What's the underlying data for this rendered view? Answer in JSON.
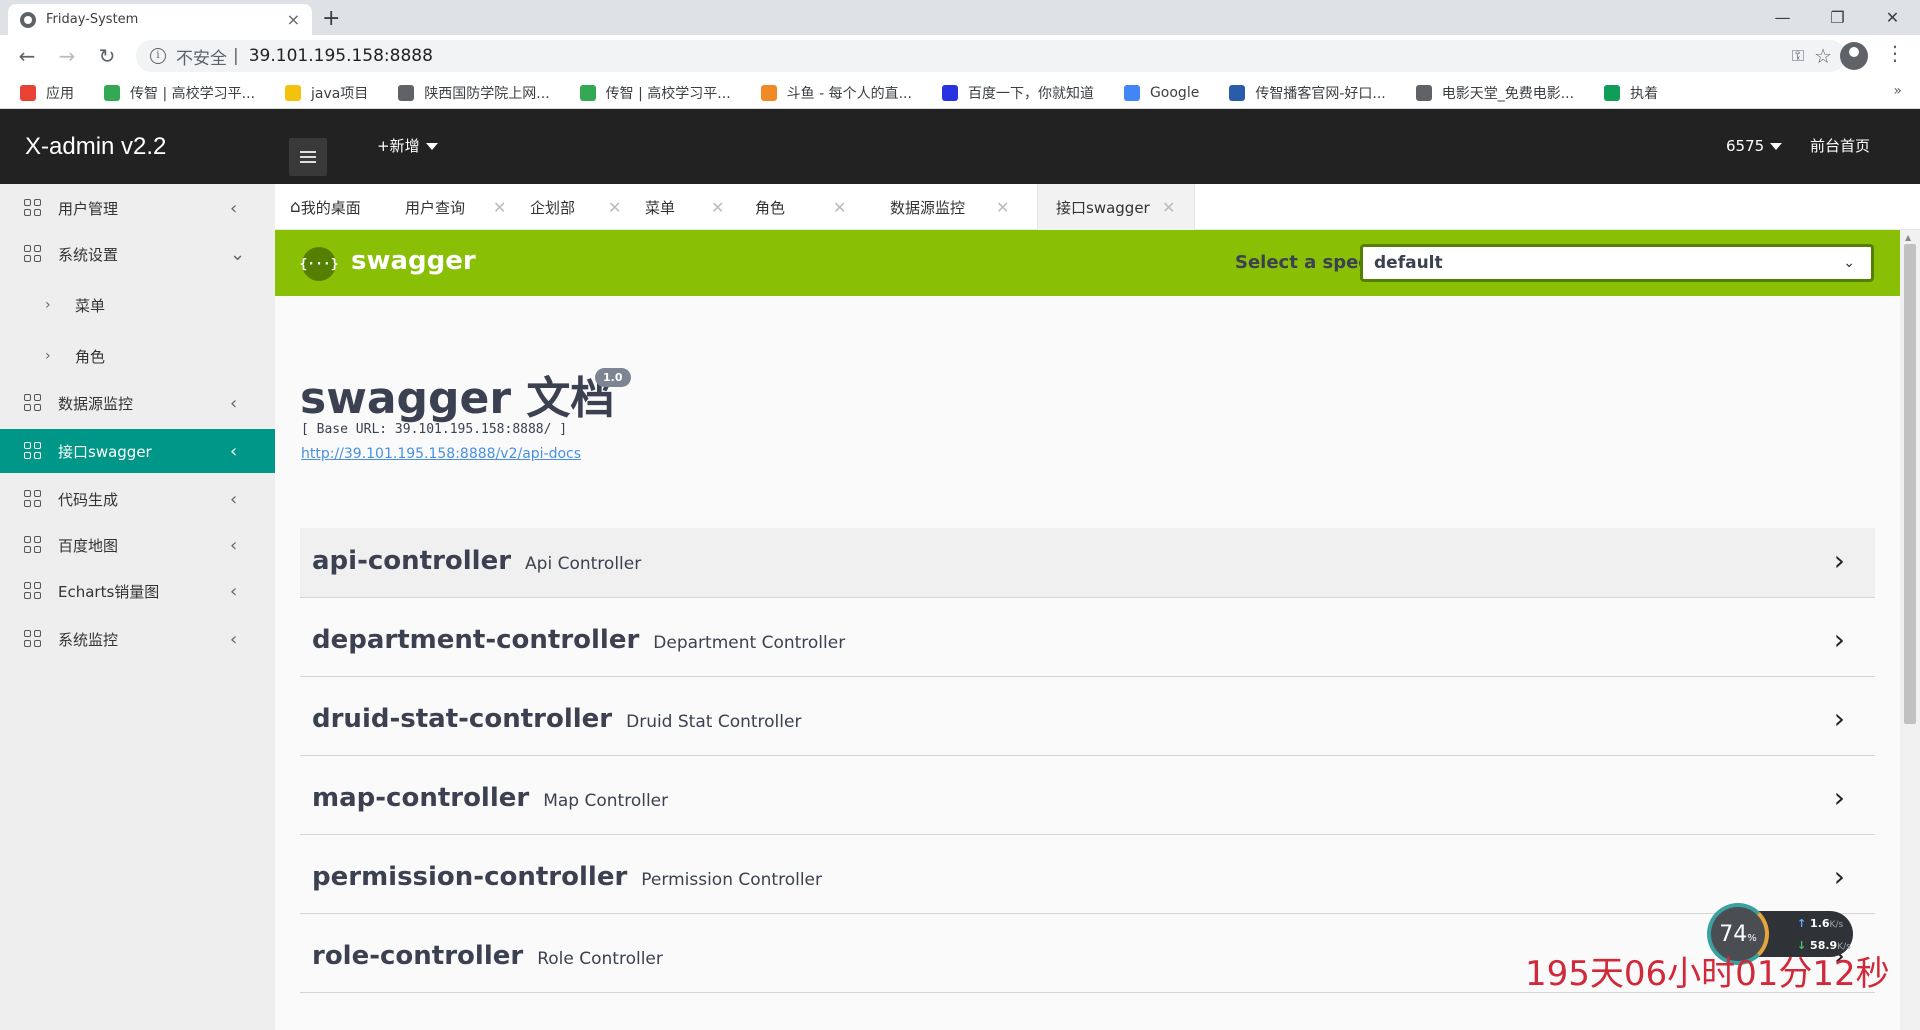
{
  "browser": {
    "tab_title": "Friday-System",
    "tab_close": "×",
    "new_tab": "+",
    "window": {
      "minimize": "—",
      "maximize": "❐",
      "close": "✕"
    },
    "insecure_label": "不安全",
    "separator": "|",
    "url": "39.101.195.158:8888",
    "bookmarks": [
      {
        "label": "应用",
        "color": "#e94235"
      },
      {
        "label": "传智 | 高校学习平...",
        "color": "#34a853"
      },
      {
        "label": "java项目",
        "color": "#f4c20d"
      },
      {
        "label": "陕西国防学院上网...",
        "color": "#5f6368"
      },
      {
        "label": "传智 | 高校学习平...",
        "color": "#34a853"
      },
      {
        "label": "斗鱼 - 每个人的直...",
        "color": "#f08a24"
      },
      {
        "label": "百度一下，你就知道",
        "color": "#2932e1"
      },
      {
        "label": "Google",
        "color": "#4285f4"
      },
      {
        "label": "传智播客官网-好口...",
        "color": "#2a5caa"
      },
      {
        "label": "电影天堂_免费电影...",
        "color": "#5f6368"
      },
      {
        "label": "执着",
        "color": "#0f9d58"
      }
    ],
    "bookmarks_more": "»"
  },
  "header": {
    "logo": "X-admin v2.2",
    "add_new": "+新增",
    "user": "6575",
    "front_page": "前台首页"
  },
  "sidebar": {
    "items": [
      {
        "label": "用户管理",
        "arrow": "‹"
      },
      {
        "label": "系统设置",
        "arrow": "⌄"
      },
      {
        "label": "菜单",
        "arrow": "›"
      },
      {
        "label": "角色",
        "arrow": "›"
      },
      {
        "label": "数据源监控",
        "arrow": "‹"
      },
      {
        "label": "接口swagger",
        "arrow": "‹"
      },
      {
        "label": "代码生成",
        "arrow": "‹"
      },
      {
        "label": "百度地图",
        "arrow": "‹"
      },
      {
        "label": "Echarts销量图",
        "arrow": "‹"
      },
      {
        "label": "系统监控",
        "arrow": "‹"
      }
    ]
  },
  "tabs": [
    {
      "label": "我的桌面"
    },
    {
      "label": "用户查询"
    },
    {
      "label": "企划部"
    },
    {
      "label": "菜单"
    },
    {
      "label": "角色"
    },
    {
      "label": "数据源监控"
    },
    {
      "label": "接口swagger"
    }
  ],
  "swagger": {
    "logo_glyph": "{···}",
    "brand": "swagger",
    "spec_label": "Select a spec",
    "spec_value": "default",
    "title": "swagger 文档",
    "version": "1.0",
    "base_url": "[ Base URL: 39.101.195.158:8888/ ]",
    "api_docs_link": "http://39.101.195.158:8888/v2/api-docs",
    "operations": [
      {
        "name": "api-controller",
        "desc": "Api Controller"
      },
      {
        "name": "department-controller",
        "desc": "Department Controller"
      },
      {
        "name": "druid-stat-controller",
        "desc": "Druid Stat Controller"
      },
      {
        "name": "map-controller",
        "desc": "Map Controller"
      },
      {
        "name": "permission-controller",
        "desc": "Permission Controller"
      },
      {
        "name": "role-controller",
        "desc": "Role Controller"
      }
    ]
  },
  "net_widget": {
    "cpu_percent": "74",
    "percent_sign": "%",
    "upload": "1.6",
    "upload_unit": "K/s",
    "download": "58.9",
    "download_unit": "K/s"
  },
  "overlay_text": "195天06小时01分12秒"
}
